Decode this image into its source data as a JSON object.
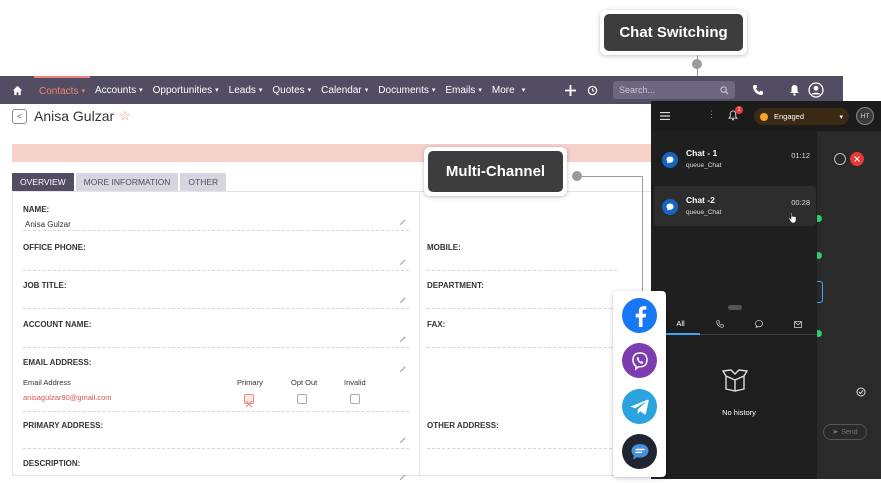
{
  "callouts": {
    "chat_switching": "Chat Switching",
    "multi_channel": "Multi-Channel"
  },
  "nav": {
    "items": [
      {
        "label": "Contacts",
        "active": true
      },
      {
        "label": "Accounts"
      },
      {
        "label": "Opportunities"
      },
      {
        "label": "Leads"
      },
      {
        "label": "Quotes"
      },
      {
        "label": "Calendar"
      },
      {
        "label": "Documents"
      },
      {
        "label": "Emails"
      },
      {
        "label": "More"
      }
    ],
    "search_placeholder": "Search..."
  },
  "record": {
    "title": "Anisa Gulzar",
    "tabs": [
      "OVERVIEW",
      "MORE INFORMATION",
      "OTHER"
    ]
  },
  "fields": {
    "name_label": "NAME:",
    "name_value": "Anisa Gulzar",
    "office_phone_label": "OFFICE PHONE:",
    "mobile_label": "MOBILE:",
    "job_title_label": "JOB TITLE:",
    "department_label": "DEPARTMENT:",
    "account_name_label": "ACCOUNT NAME:",
    "fax_label": "FAX:",
    "email_label": "EMAIL ADDRESS:",
    "email_sub_label": "Email Address",
    "primary_label": "Primary",
    "opt_out_label": "Opt Out",
    "invalid_label": "Invalid",
    "email_value": "anisagulzar90@gmail.com",
    "primary_address_label": "PRIMARY ADDRESS:",
    "other_address_label": "OTHER ADDRESS:",
    "description_label": "DESCRIPTION:"
  },
  "chat": {
    "notification_count": "1",
    "status": "Engaged",
    "avatar_initials": "HT",
    "items": [
      {
        "name": "Chat - 1",
        "queue": "queue_Chat",
        "time": "01:12"
      },
      {
        "name": "Chat -2",
        "queue": "queue_Chat",
        "time": "00:28"
      }
    ],
    "history_tab_all": "All",
    "no_history": "No history",
    "send_label": "Send"
  },
  "colors": {
    "nav_bg": "#534d64",
    "accent": "#f08377",
    "facebook": "#1877f2",
    "viber": "#7d3daf",
    "telegram": "#2aa3df",
    "chat_bg": "#252525"
  }
}
